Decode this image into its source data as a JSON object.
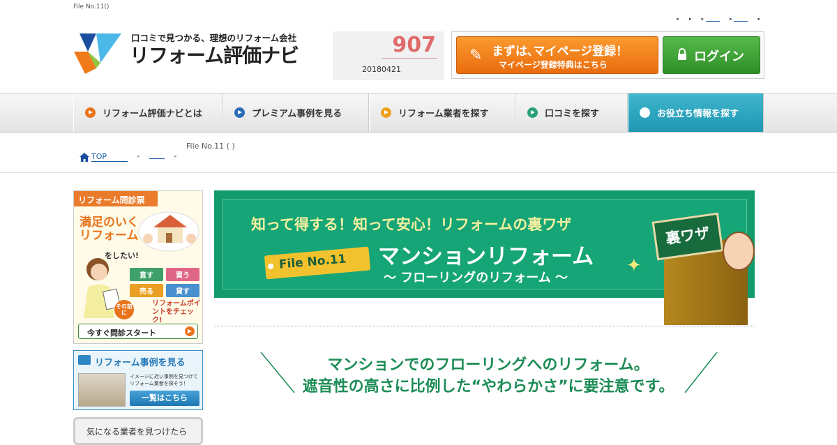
{
  "page": {
    "tiny_title": "File No.11()"
  },
  "header": {
    "logo_tagline": "口コミで見つかる、理想のリフォーム会社",
    "logo_name": "リフォーム評価ナビ",
    "counter_value": "907",
    "counter_date": "20180421"
  },
  "cta": {
    "register_line1": "まずは､マイページ登録！",
    "register_line2": "マイページ登録特典はこちら",
    "login_label": "ログイン"
  },
  "nav": {
    "items": [
      {
        "label": "リフォーム評価ナビとは",
        "color": "#e8731a"
      },
      {
        "label": "プレミアム事例を見る",
        "color": "#2a6db5"
      },
      {
        "label": "リフォーム業者を探す",
        "color": "#f0a020"
      },
      {
        "label": "口コミを探す",
        "color": "#2aa07a"
      },
      {
        "label": "お役立ち情報を探す",
        "color": "#ffffff"
      }
    ]
  },
  "breadcrumb": {
    "home": "TOP",
    "current": "File No.11 ( )"
  },
  "sidebar": {
    "diagnosis": {
      "header": "リフォーム問診票",
      "big_text": "満足のいくリフォーム",
      "small_text": "をしたい!",
      "options": [
        "直す",
        "買う",
        "売る",
        "貸す"
      ],
      "badge": "その前に",
      "check_text": "リフォームポイントをチェック!",
      "start": "今すぐ問診スタート"
    },
    "cases": {
      "title": "リフォーム事例を見る",
      "description": "イメージに近い事例を見つけてリフォーム業者を探そう！",
      "button": "一覧はこちら"
    },
    "found": {
      "text": "気になる業者を見つけたら"
    }
  },
  "banner": {
    "tagline": "知って得する！知って安心！リフォームの裏ワザ",
    "file_tag": "File No.11",
    "title": "マンションリフォーム",
    "subtitle": "〜 フローリングのリフォーム 〜",
    "sign": "裏ワザ"
  },
  "article": {
    "heading_line1": "マンションでのフローリングへのリフォーム。",
    "heading_line2": "遮音性の高さに比例した“やわらかさ”に要注意です。"
  }
}
